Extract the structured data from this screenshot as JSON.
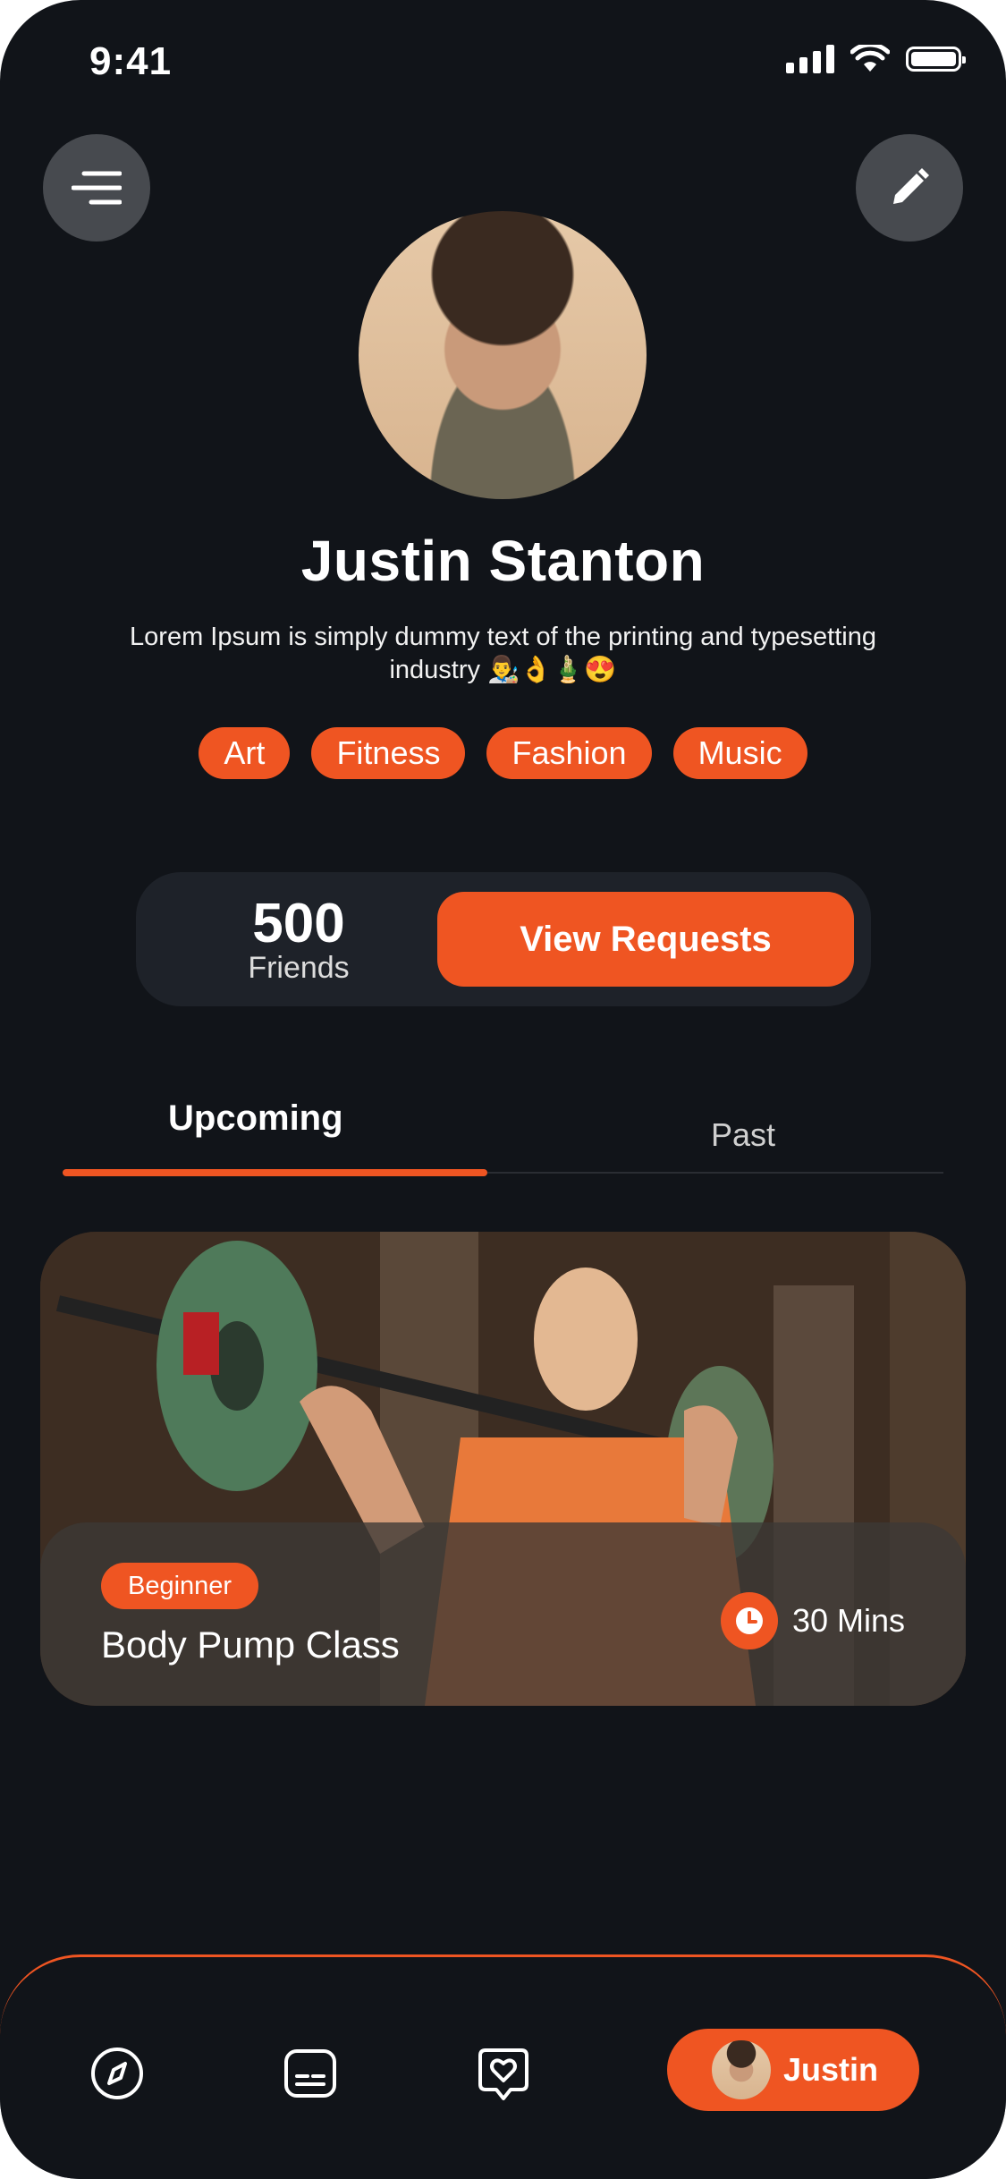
{
  "status_bar": {
    "time": "9:41"
  },
  "profile": {
    "name": "Justin Stanton",
    "bio": "Lorem Ipsum is simply dummy text of the printing and typesetting industry 👨‍🎨👌🎍😍",
    "interests": [
      "Art",
      "Fitness",
      "Fashion",
      "Music"
    ]
  },
  "friends": {
    "count": "500",
    "label": "Friends",
    "button_label": "View Requests"
  },
  "tabs": {
    "upcoming": "Upcoming",
    "past": "Past",
    "active": "upcoming"
  },
  "class_card": {
    "level": "Beginner",
    "title": "Body Pump Class",
    "duration": "30 Mins"
  },
  "bottom_nav": {
    "items": [
      "compass-icon",
      "captions-icon",
      "heart-chat-icon"
    ],
    "profile_name": "Justin"
  },
  "colors": {
    "accent": "#ef5522",
    "background": "#111419",
    "card": "#1e2229"
  }
}
